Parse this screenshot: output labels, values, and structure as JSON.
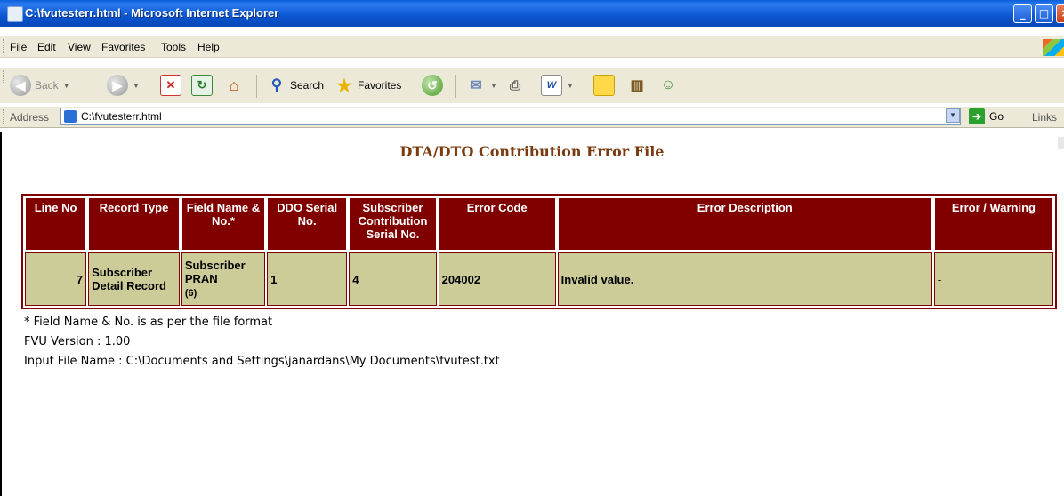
{
  "window": {
    "title": "C:\\fvutesterr.html - Microsoft Internet Explorer",
    "controls": [
      "minimize",
      "maximize",
      "close"
    ]
  },
  "menu": {
    "items": [
      "File",
      "Edit",
      "View",
      "Favorites",
      "Tools",
      "Help"
    ]
  },
  "toolbar": {
    "back_label": "Back",
    "search_label": "Search",
    "favorites_label": "Favorites"
  },
  "address": {
    "label": "Address",
    "value": "C:\\fvutesterr.html",
    "go_label": "Go",
    "links_label": "Links"
  },
  "page": {
    "title": "DTA/DTO Contribution Error File",
    "columns": [
      "Line No",
      "Record Type",
      "Field Name & No.*",
      "DDO Serial No.",
      "Subscriber Contribution Serial No.",
      "Error Code",
      "Error Description",
      "Error / Warning"
    ],
    "rows": [
      {
        "line_no": "7",
        "record_type": "Subscriber Detail Record",
        "field_name": "Subscriber PRAN",
        "field_no": "(6)",
        "ddo_serial": "1",
        "contrib_serial": "4",
        "error_code": "204002",
        "error_description": "Invalid value.",
        "error_warning": "-"
      }
    ],
    "footnote": "* Field Name & No. is as per the file format",
    "fvu_version": "FVU Version : 1.00",
    "input_file": "Input File Name : C:\\Documents and Settings\\janardans\\My Documents\\fvutest.txt"
  },
  "colors": {
    "header_bg": "#800000",
    "row_bg": "#cccc99",
    "title_color": "#7b3a10"
  }
}
